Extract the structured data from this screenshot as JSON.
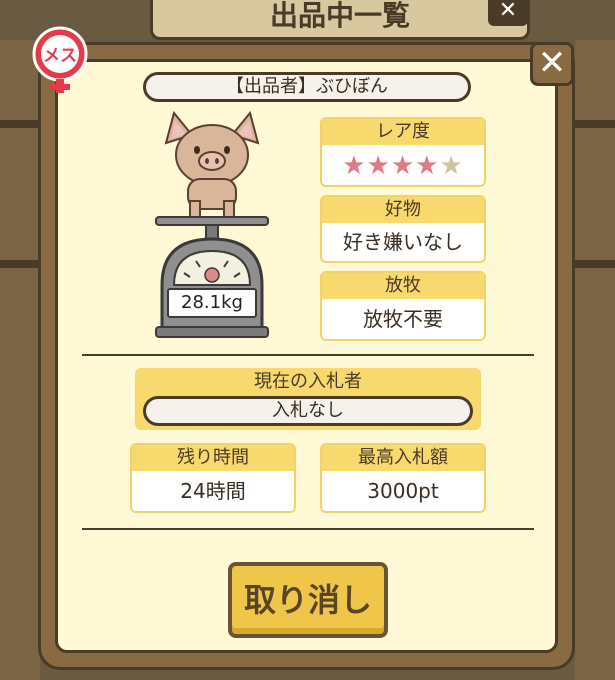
{
  "background": {
    "title": "出品中一覧",
    "close_symbol": "✕"
  },
  "dialog": {
    "close_symbol": "✕",
    "gender_badge": "メス",
    "seller_label": "【出品者】ぶひぼん",
    "weight": "28.1kg",
    "rarity": {
      "header": "レア度",
      "stars_filled": 4,
      "stars_total": 5
    },
    "preference": {
      "header": "好物",
      "value": "好き嫌いなし"
    },
    "grazing": {
      "header": "放牧",
      "value": "放牧不要"
    },
    "current_bidder": {
      "header": "現在の入札者",
      "value": "入札なし"
    },
    "remaining_time": {
      "header": "残り時間",
      "value": "24時間"
    },
    "highest_bid": {
      "header": "最高入札額",
      "value": "3000pt"
    },
    "cancel_button": "取り消し"
  },
  "colors": {
    "panel_frame": "#8a6a42",
    "panel_bg": "#fff9d6",
    "card_header": "#f7d96e",
    "star_filled": "#e07a86",
    "star_empty": "#cfc3a0",
    "badge_red": "#e43a4a"
  }
}
